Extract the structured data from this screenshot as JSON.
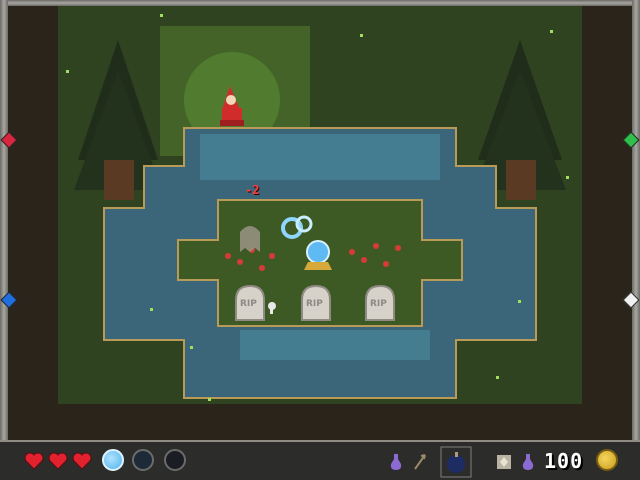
{
  "world": {
    "tombstones": [
      {
        "label": "RIP"
      },
      {
        "label": "RIP"
      },
      {
        "label": "RIP"
      }
    ],
    "damage_indicator": "-2"
  },
  "hud": {
    "hearts_full": 3,
    "mana_orbs": [
      {
        "state": "full",
        "color": "#4fb3e8"
      },
      {
        "state": "empty",
        "color": "#1d2a38"
      },
      {
        "state": "empty",
        "color": "#1b1d24"
      }
    ],
    "coins": "100",
    "icons": [
      "potion-icon",
      "arrow-icon",
      "bomb-icon",
      "crystal-icon",
      "potion-icon",
      "coin-icon"
    ]
  },
  "colors": {
    "grass_dark": "#2d3d1e",
    "grass": "#4a6a2a",
    "water": "#3f6f84",
    "water_light": "#4d91a8",
    "heart": "#e2232f",
    "gem_red": "#d7263d",
    "gem_blue": "#1f6fe0",
    "gem_green": "#2fbf4a",
    "gem_white": "#f0f0f0"
  }
}
